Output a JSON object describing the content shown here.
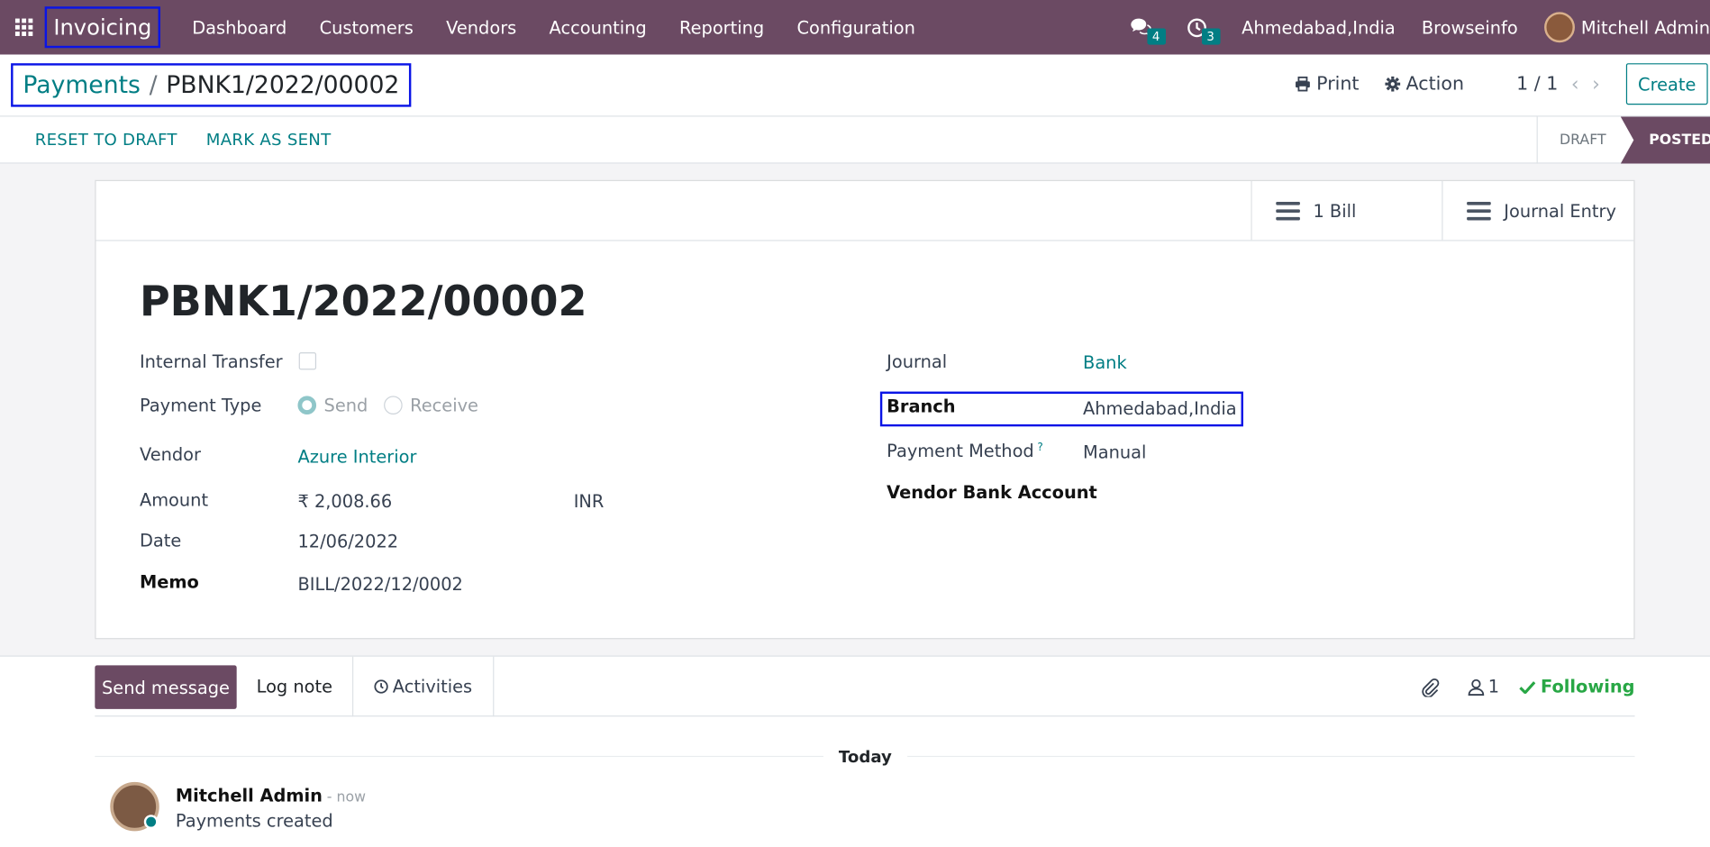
{
  "navbar": {
    "app_name": "Invoicing",
    "menu": [
      "Dashboard",
      "Customers",
      "Vendors",
      "Accounting",
      "Reporting",
      "Configuration"
    ],
    "messages_count": "4",
    "activities_count": "3",
    "branch": "Ahmedabad,India",
    "company": "Browseinfo",
    "user": "Mitchell Admin"
  },
  "breadcrumb": {
    "parent": "Payments",
    "separator": "/",
    "current": "PBNK1/2022/00002"
  },
  "control": {
    "print_label": "Print",
    "action_label": "Action",
    "pager": "1 / 1",
    "create_label": "Create"
  },
  "statusbar": {
    "reset_label": "RESET TO DRAFT",
    "mark_sent_label": "MARK AS SENT",
    "stages": [
      "DRAFT",
      "POSTED"
    ],
    "active_stage": "POSTED"
  },
  "smart_buttons": {
    "bill": "1 Bill",
    "journal_entry": "Journal Entry"
  },
  "record": {
    "title": "PBNK1/2022/00002",
    "internal_transfer_label": "Internal Transfer",
    "internal_transfer": false,
    "payment_type_label": "Payment Type",
    "payment_type_options": [
      "Send",
      "Receive"
    ],
    "payment_type": "Send",
    "vendor_label": "Vendor",
    "vendor": "Azure Interior",
    "amount_label": "Amount",
    "amount": "₹ 2,008.66",
    "currency": "INR",
    "date_label": "Date",
    "date": "12/06/2022",
    "memo_label": "Memo",
    "memo": "BILL/2022/12/0002",
    "journal_label": "Journal",
    "journal": "Bank",
    "branch_label": "Branch",
    "branch": "Ahmedabad,India",
    "payment_method_label": "Payment Method",
    "payment_method_help": "?",
    "payment_method": "Manual",
    "vendor_bank_label": "Vendor Bank Account"
  },
  "chatter": {
    "send_message": "Send message",
    "log_note": "Log note",
    "activities": "Activities",
    "followers_count": "1",
    "following": "Following",
    "date_separator": "Today",
    "messages": [
      {
        "author": "Mitchell Admin",
        "time": "- now",
        "body": "Payments created"
      }
    ]
  },
  "colors": {
    "brand": "#6b4a63",
    "link": "#017e84",
    "highlight_box": "#0a14e6",
    "following": "#28a745"
  }
}
